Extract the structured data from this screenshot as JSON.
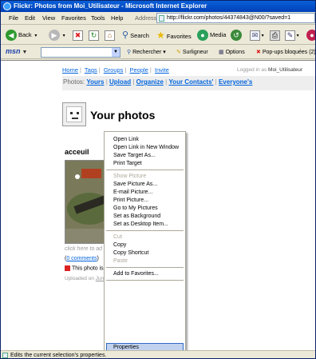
{
  "window": {
    "title": "Flickr: Photos from Moi_Utilisateur - Microsoft Internet Explorer"
  },
  "menubar": {
    "items": [
      "File",
      "Edit",
      "View",
      "Favorites",
      "Tools",
      "Help"
    ],
    "address_label": "Address",
    "address_value": "http://flickr.com/photos/44374843@N00/?saved=1"
  },
  "toolbar": {
    "back": "Back",
    "search": "Search",
    "favorites": "Favorites",
    "media": "Media"
  },
  "msnbar": {
    "logo": "msn",
    "rechercher": "Rechercher",
    "surligneur": "Surligneur",
    "options": "Options",
    "popups": "Pop-ups bloquées (2)"
  },
  "page": {
    "topnav": [
      "Home",
      "Tags",
      "Groups",
      "People",
      "Invite"
    ],
    "logged_in_prefix": "Logged in as",
    "logged_in_user": "Moi_Utilisateur",
    "photos_label": "Photos:",
    "photos_nav": [
      "Yours",
      "Upload",
      "Organize",
      "Your Contacts'",
      "Everyone's"
    ],
    "title": "Your photos",
    "photo_title": "acceuil",
    "click_hint": "click here to ad",
    "comments_prefix": "(",
    "comments_link": "0 comments",
    "comments_suffix": ")",
    "private_text": "This photo is",
    "uploaded_prefix": "Uploaded on",
    "uploaded_link": "Jun"
  },
  "context_menu": {
    "group1": [
      "Open Link",
      "Open Link in New Window",
      "Save Target As...",
      "Print Target"
    ],
    "group2": [
      {
        "label": "Show Picture",
        "disabled": true
      },
      {
        "label": "Save Picture As...",
        "disabled": false
      },
      {
        "label": "E-mail Picture...",
        "disabled": false
      },
      {
        "label": "Print Picture...",
        "disabled": false
      },
      {
        "label": "Go to My Pictures",
        "disabled": false
      },
      {
        "label": "Set as Background",
        "disabled": false
      },
      {
        "label": "Set as Desktop Item...",
        "disabled": false
      }
    ],
    "group3": [
      {
        "label": "Cut",
        "disabled": true
      },
      {
        "label": "Copy",
        "disabled": false
      },
      {
        "label": "Copy Shortcut",
        "disabled": false
      },
      {
        "label": "Paste",
        "disabled": true
      }
    ],
    "group4": [
      "Add to Favorites..."
    ],
    "group5": [
      "Properties"
    ],
    "highlighted": "Properties"
  },
  "status": {
    "text": "Edits the current selection's properties."
  },
  "colors": {
    "link": "#0063dc",
    "titlebar": "#0a5fd8",
    "highlight": "#c1d2ee"
  }
}
